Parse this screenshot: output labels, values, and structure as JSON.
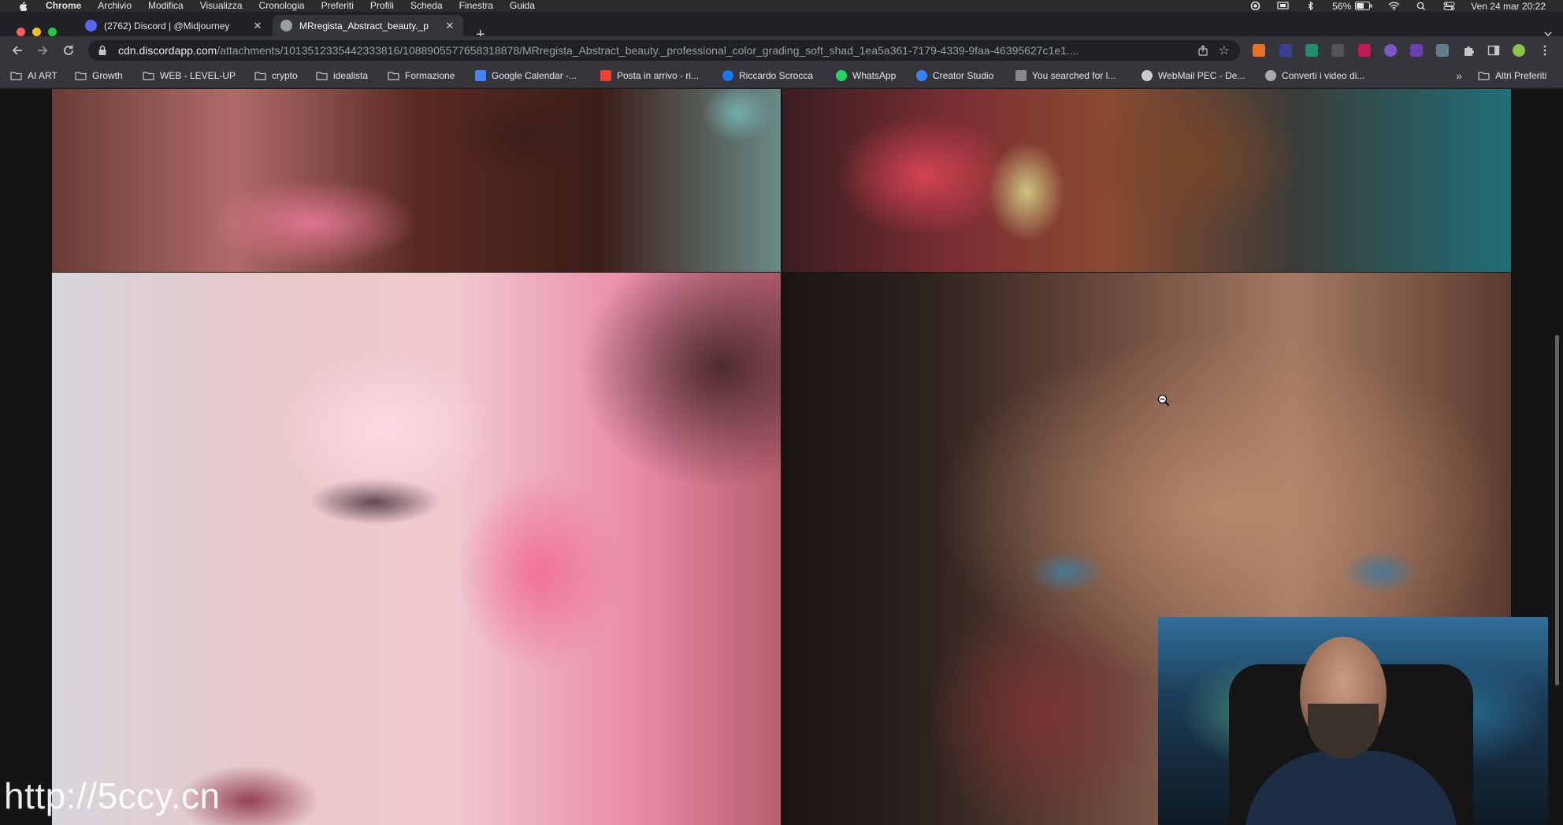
{
  "menubar": {
    "app": "Chrome",
    "items": [
      "Archivio",
      "Modifica",
      "Visualizza",
      "Cronologia",
      "Preferiti",
      "Profili",
      "Scheda",
      "Finestra",
      "Guida"
    ],
    "battery": "56%",
    "datetime": "Ven 24 mar  20:22"
  },
  "tabs": [
    {
      "title": "(2762) Discord | @Midjourney",
      "favicon_color": "#5865f2",
      "active": false
    },
    {
      "title": "MRregista_Abstract_beauty._p",
      "favicon_color": "#9aa0a6",
      "active": true
    }
  ],
  "omnibox": {
    "host": "cdn.discordapp.com",
    "path": "/attachments/1013512335442333816/1088905577658318878/MRregista_Abstract_beauty._professional_color_grading_soft_shad_1ea5a361-7179-4339-9faa-46395627c1e1...."
  },
  "bookmarks": [
    {
      "label": "AI ART",
      "type": "folder"
    },
    {
      "label": "Growth",
      "type": "folder"
    },
    {
      "label": "WEB - LEVEL-UP",
      "type": "folder"
    },
    {
      "label": "crypto",
      "type": "folder"
    },
    {
      "label": "idealista",
      "type": "folder"
    },
    {
      "label": "Formazione",
      "type": "folder"
    },
    {
      "label": "Google Calendar -...",
      "type": "link",
      "color": "#4285f4"
    },
    {
      "label": "Posta in arrivo - ri...",
      "type": "link",
      "color": "#ea4335"
    },
    {
      "label": "Riccardo Scrocca",
      "type": "link",
      "color": "#1877f2"
    },
    {
      "label": "WhatsApp",
      "type": "link",
      "color": "#25d366"
    },
    {
      "label": "Creator Studio",
      "type": "link",
      "color": "#3b82f6"
    },
    {
      "label": "You searched for l...",
      "type": "link",
      "color": "#888888"
    },
    {
      "label": "WebMail PEC - De...",
      "type": "link",
      "color": "#cccccc"
    },
    {
      "label": "Converti i video di...",
      "type": "link",
      "color": "#aaaaaa"
    }
  ],
  "bookmarks_other": "Altri Preferiti",
  "watermark": "http://5ccy.cn",
  "icons": {
    "apple": "apple-icon",
    "back": "back-arrow-icon",
    "forward": "forward-arrow-icon",
    "reload": "reload-icon",
    "lock": "lock-icon",
    "share": "share-icon",
    "bookmark_star": "star-icon",
    "extensions": "puzzle-icon",
    "zoom_cursor": "zoom-out-cursor-icon"
  }
}
